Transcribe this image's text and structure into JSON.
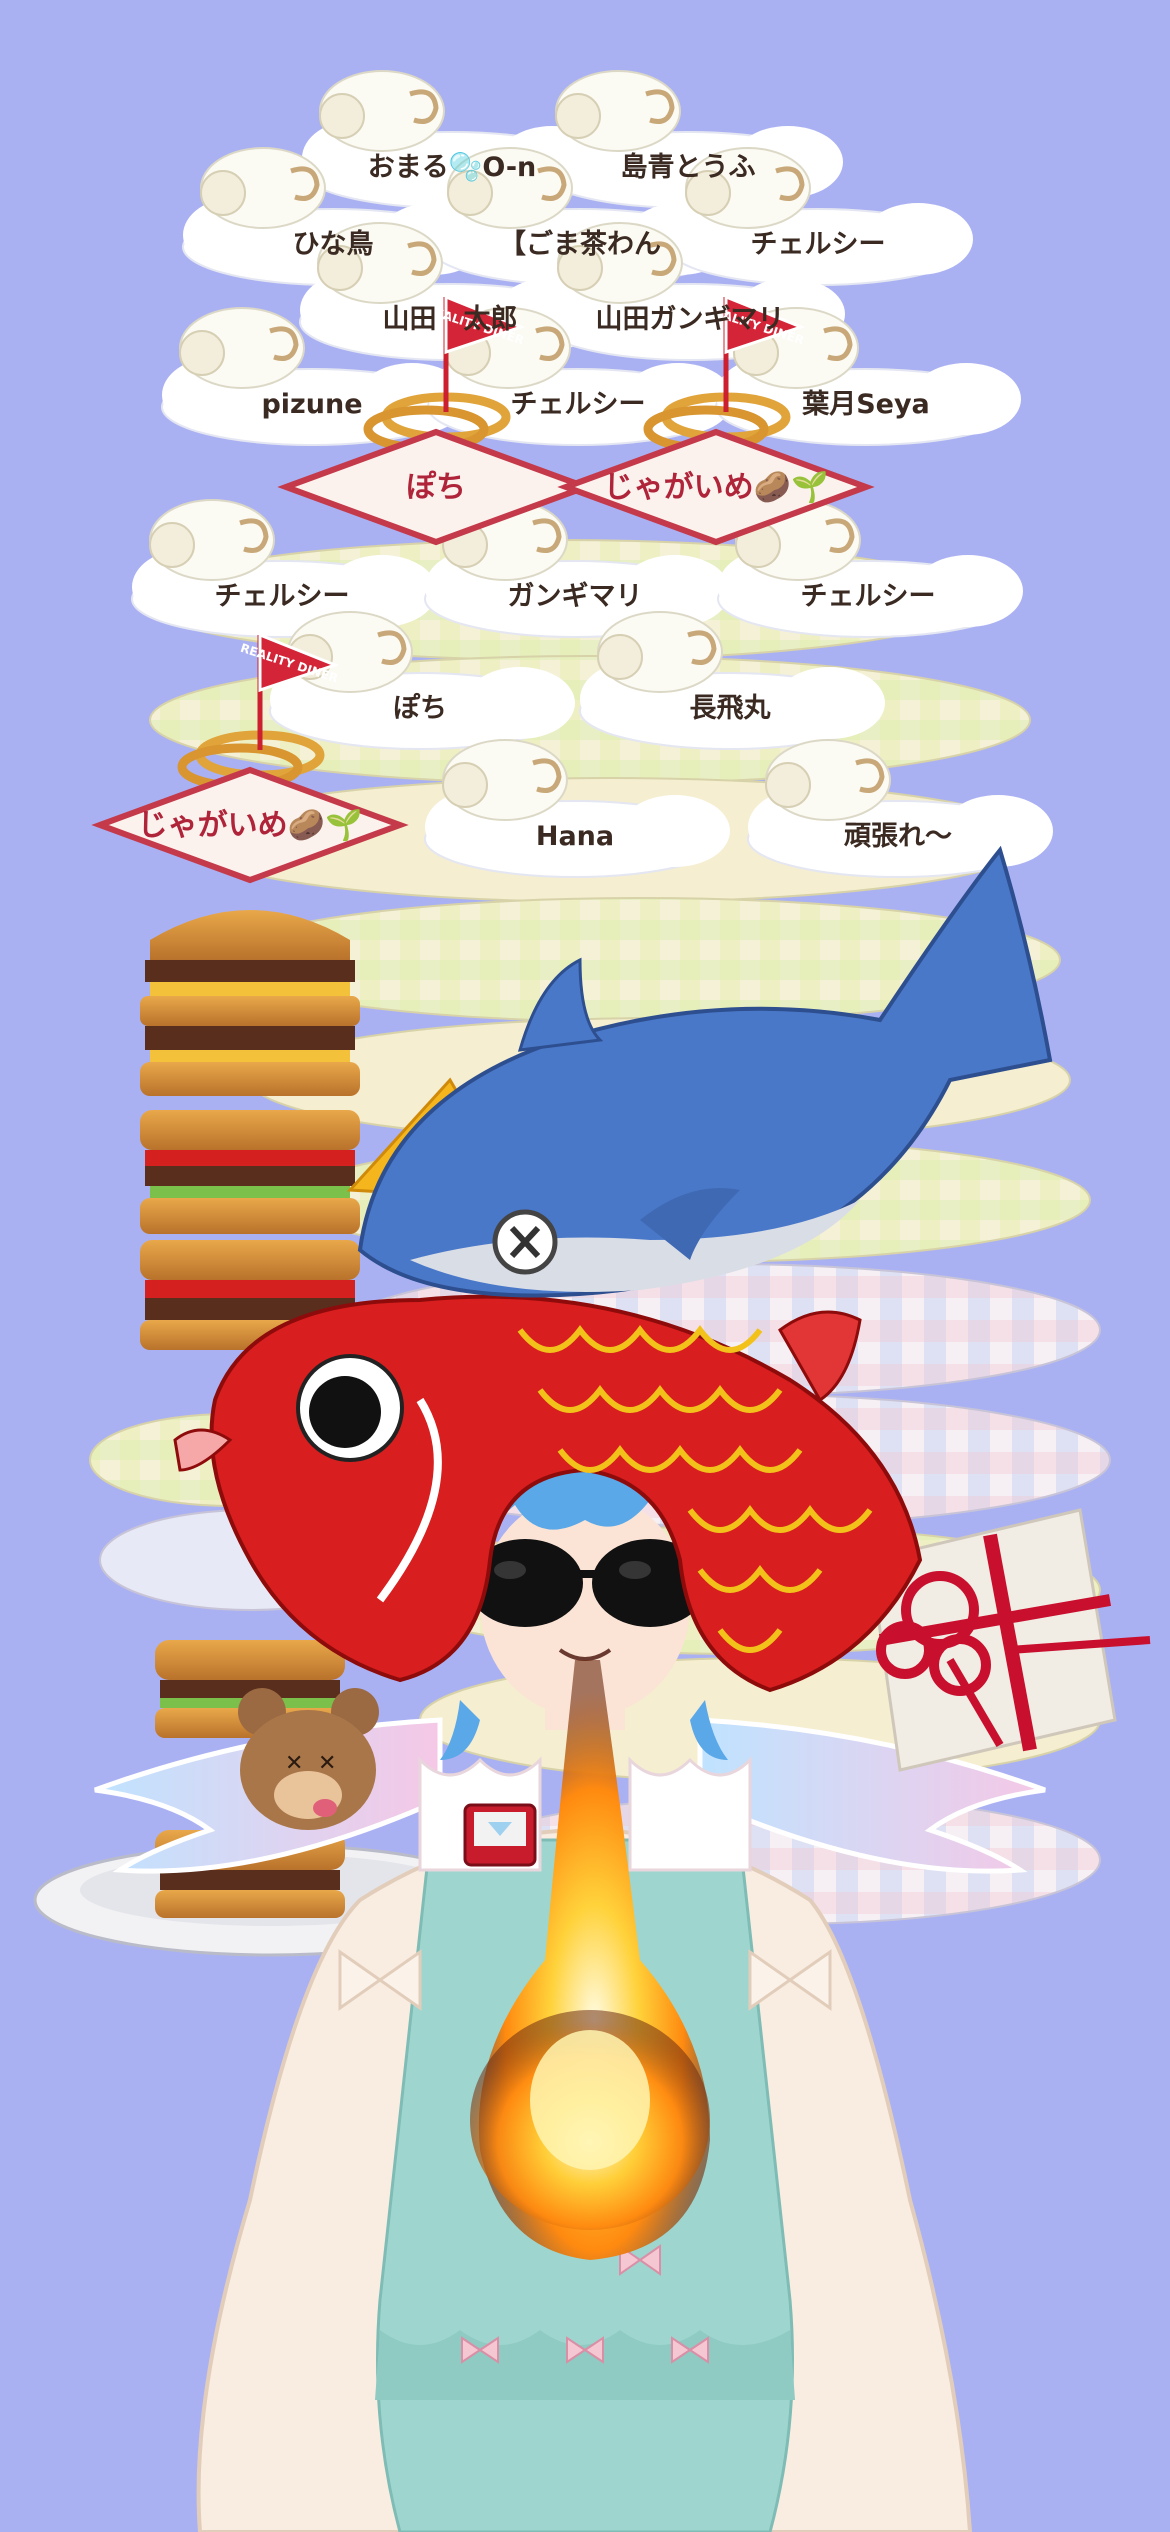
{
  "gift_tags": [
    {
      "id": "t1",
      "text": "おまる🫧O-n",
      "kind": "cloud"
    },
    {
      "id": "t2",
      "text": "島青とうふ",
      "kind": "cloud"
    },
    {
      "id": "t3",
      "text": "ひな鳥",
      "kind": "cloud"
    },
    {
      "id": "t4",
      "text": "【ごま茶わん",
      "kind": "cloud"
    },
    {
      "id": "t5",
      "text": "チェルシー",
      "kind": "cloud"
    },
    {
      "id": "t6",
      "text": "山田　太郎",
      "kind": "cloud"
    },
    {
      "id": "t7",
      "text": "山田ガンギマリ",
      "kind": "cloud"
    },
    {
      "id": "t8",
      "text": "pizune",
      "kind": "cloud"
    },
    {
      "id": "t9",
      "text": "チェルシー",
      "kind": "cloud"
    },
    {
      "id": "t10",
      "text": "葉月Seya",
      "kind": "cloud"
    },
    {
      "id": "t11",
      "text": "ぽち",
      "kind": "sign"
    },
    {
      "id": "t12",
      "text": "じゃがいめ🥔🌱",
      "kind": "sign"
    },
    {
      "id": "t13",
      "text": "チェルシー",
      "kind": "cloud"
    },
    {
      "id": "t14",
      "text": "ガンギマリ",
      "kind": "cloud"
    },
    {
      "id": "t15",
      "text": "チェルシー",
      "kind": "cloud"
    },
    {
      "id": "t16",
      "text": "ぽち",
      "kind": "cloud"
    },
    {
      "id": "t17",
      "text": "長飛丸",
      "kind": "cloud"
    },
    {
      "id": "t18",
      "text": "じゃがいめ🥔🌱",
      "kind": "sign"
    },
    {
      "id": "t19",
      "text": "Hana",
      "kind": "cloud"
    },
    {
      "id": "t20",
      "text": "頑張れ～",
      "kind": "cloud"
    }
  ],
  "flag_text": "REALITY DINER",
  "colors": {
    "background": "#aab1f3",
    "cloud": "#ffffff",
    "sign_border": "#c43a4a",
    "koi_red": "#d81e1e",
    "koi_scale": "#f2c21b",
    "shark": "#4a78c9",
    "fire": "#ffb400"
  }
}
